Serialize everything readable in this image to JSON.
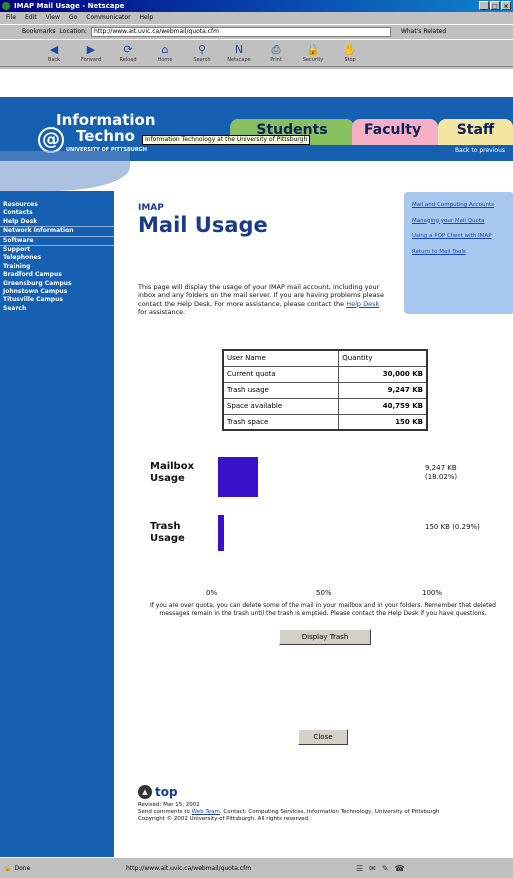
{
  "window": {
    "title": "IMAP Mail Usage - Netscape",
    "controls": [
      "_",
      "□",
      "×"
    ]
  },
  "menubar": {
    "items": [
      "File",
      "Edit",
      "View",
      "Go",
      "Communicator",
      "Help"
    ]
  },
  "addressbar": {
    "bookmarks_label": "Bookmarks",
    "location_label": "Location:",
    "url": "http://www.ait.uvic.ca/webmail/quota.cfm",
    "related_label": "What's Related"
  },
  "toolbar": {
    "items": [
      {
        "label": "Back",
        "icon": "back-arrow-icon",
        "glyph": "◀"
      },
      {
        "label": "Forward",
        "icon": "forward-arrow-icon",
        "glyph": "▶"
      },
      {
        "label": "Reload",
        "icon": "reload-icon",
        "glyph": "⟳"
      },
      {
        "label": "Home",
        "icon": "home-icon",
        "glyph": "⌂"
      },
      {
        "label": "Search",
        "icon": "search-icon",
        "glyph": "⚲"
      },
      {
        "label": "Netscape",
        "icon": "netscape-icon",
        "glyph": "N"
      },
      {
        "label": "Print",
        "icon": "print-icon",
        "glyph": "⎙"
      },
      {
        "label": "Security",
        "icon": "security-icon",
        "glyph": "🔒"
      },
      {
        "label": "Stop",
        "icon": "stop-icon",
        "glyph": "✋"
      }
    ]
  },
  "header": {
    "logo_line1": "Information",
    "logo_line2": "Techno",
    "logo_symbol": "@",
    "logo_sub": "UNIVERSITY OF PITTSBURGH",
    "tabs": [
      "Students",
      "Faculty",
      "Staff"
    ],
    "tooltip": "Information Technology at the University of Pittsburgh",
    "back_link": "Back to previous"
  },
  "sidebar": {
    "items": [
      "Resources",
      "Contacts",
      "Help Desk",
      "Network Information",
      "Software",
      "Support",
      "Telephones",
      "Training",
      "Bradford Campus",
      "Greensburg Campus",
      "Johnstown Campus",
      "Titusville Campus",
      "Search"
    ]
  },
  "page": {
    "kicker": "IMAP",
    "title": "Mail Usage",
    "intro": "This page will display the usage of your IMAP mail account, including your inbox and any folders on the mail server. If you are having problems please contact the Help Desk. For more assistance, please contact the ",
    "intro_link": "Help Desk",
    "intro_tail": " for assistance."
  },
  "sidenote": {
    "links": [
      "Mail and Computing Accounts",
      "Managing your Mail Quota",
      "Using a POP Client with IMAP",
      "Return to Mail Tools"
    ]
  },
  "usage_table": {
    "header": [
      "User Name",
      "Quantity"
    ],
    "rows": [
      {
        "label": "Current quota",
        "value": "30,000 KB"
      },
      {
        "label": "Trash usage",
        "value": "9,247 KB"
      },
      {
        "label": "Space available",
        "value": "40,759 KB"
      },
      {
        "label": "Trash space",
        "value": "150 KB"
      }
    ]
  },
  "chart": {
    "mailbox_label": "Mailbox Usage",
    "mailbox_value": "9,247 KB (18.02%)",
    "mailbox_fraction": 0.18,
    "trash_label": "Trash Usage",
    "trash_value": "150 KB (0.29%)",
    "trash_fraction": 0.03,
    "scale": [
      "0%",
      "50%",
      "100%"
    ]
  },
  "footnote": "If you are over quota, you can delete some of the mail in your mailbox and in your folders. Remember that deleted messages remain in the trash until the trash is emptied. Please contact the Help Desk if you have questions.",
  "buttons": {
    "display": "Display Trash",
    "close": "Close"
  },
  "footer": {
    "top_label": "top",
    "line1": "Revised: Mar 15, 2002",
    "line2_pre": "Send comments to ",
    "line2_link": "Web Team",
    "line2_post": ". Contact: Computing Services, Information Technology, University of Pittsburgh",
    "line3": "Copyright © 2002 University of Pittsburgh. All rights reserved."
  },
  "statusbar": {
    "left": "Done",
    "url": "http://www.ait.uvic.ca/webmail/quota.cfm"
  }
}
